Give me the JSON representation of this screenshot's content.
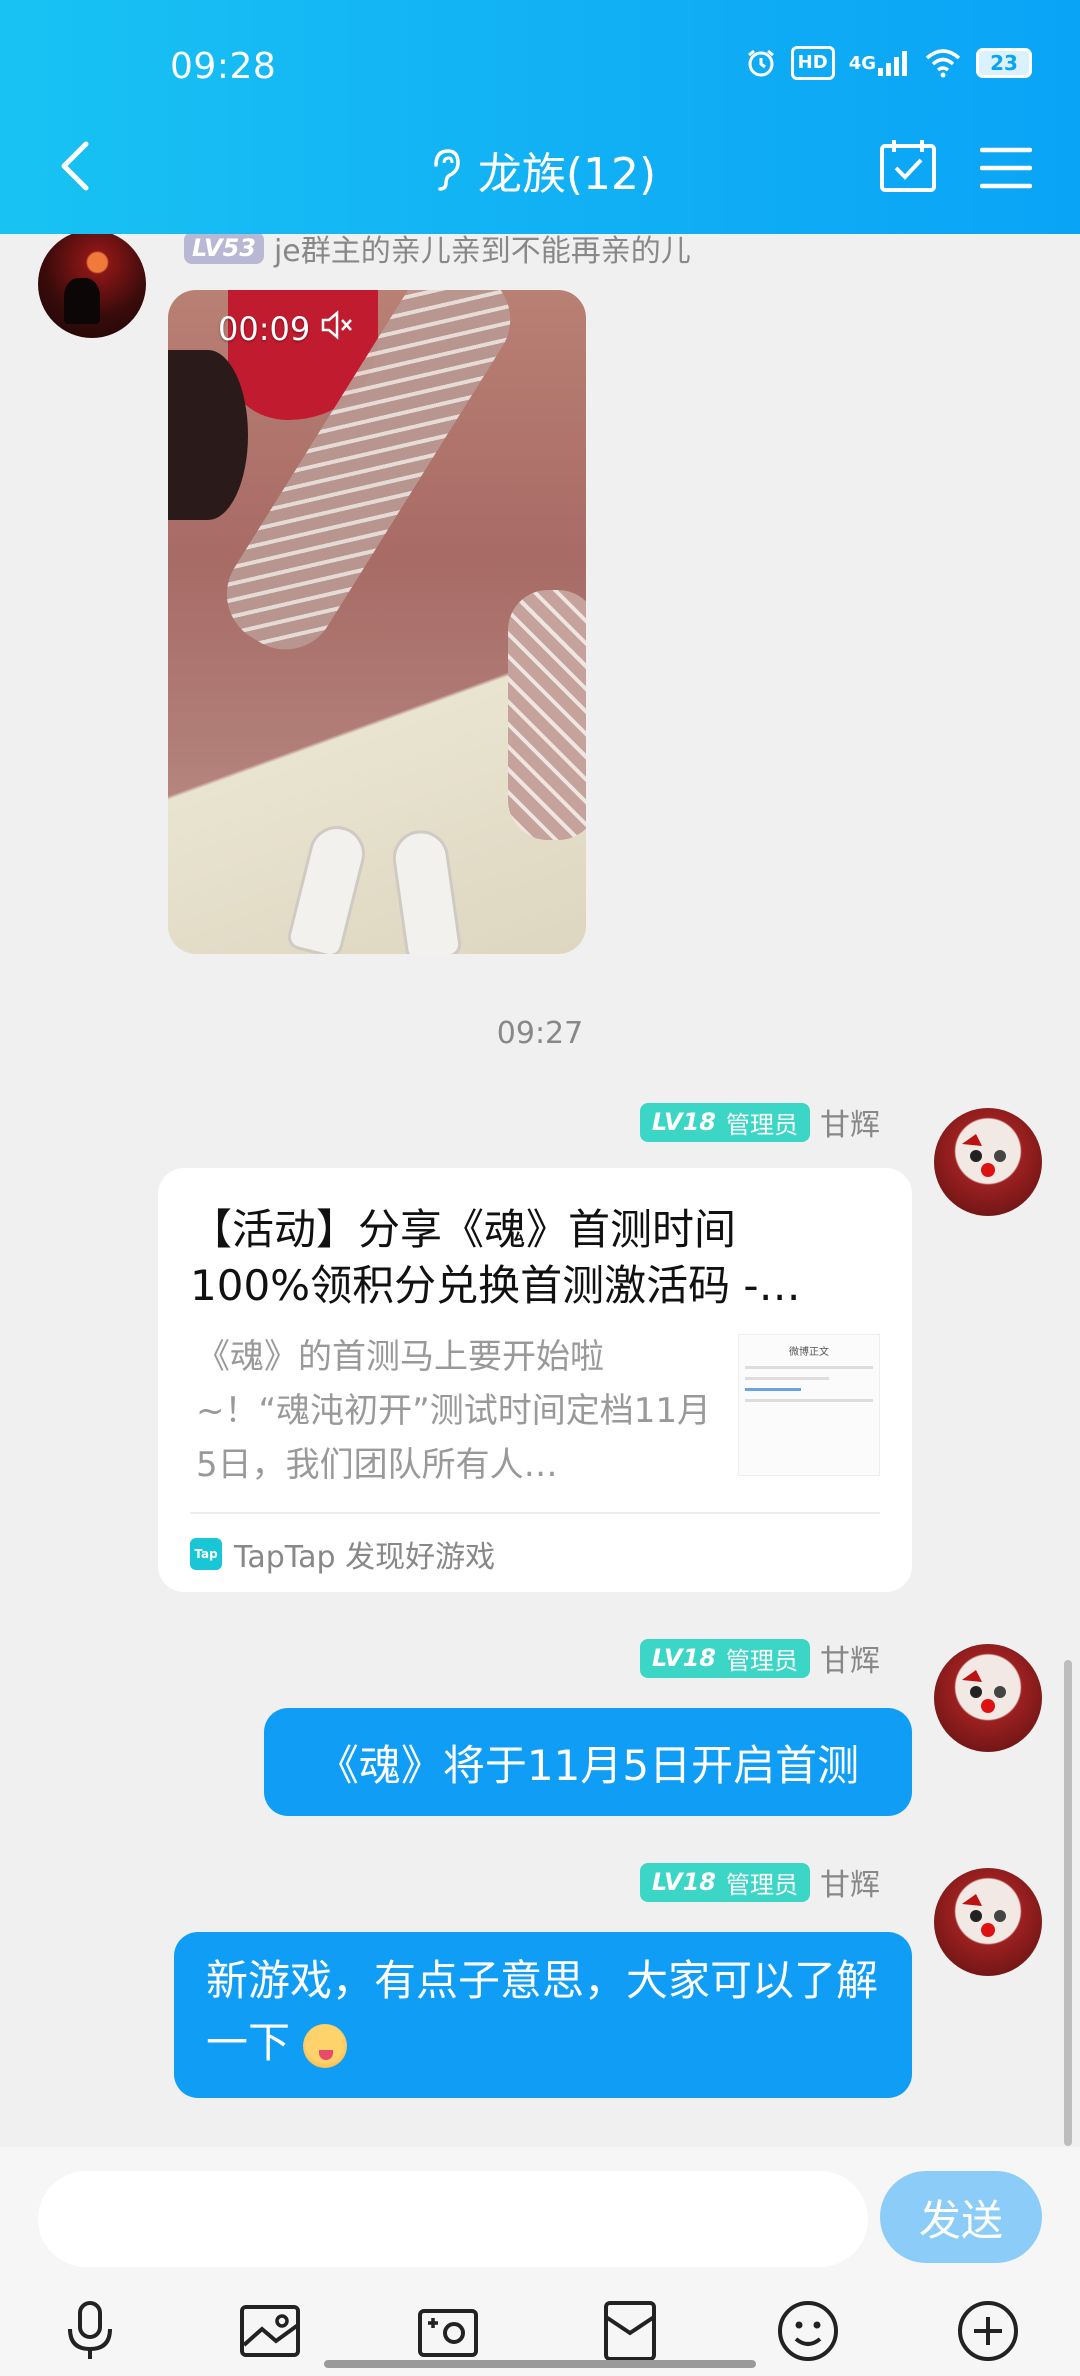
{
  "status_bar": {
    "time": "09:28",
    "hd": "HD",
    "network": "4G",
    "battery": "23"
  },
  "header": {
    "title": "龙族(12)"
  },
  "messages": {
    "first": {
      "level": "LV53",
      "sender": "je群主的亲儿亲到不能再亲的儿",
      "video_duration": "00:09"
    },
    "time_separator": "09:27",
    "admin": {
      "level": "LV18",
      "role": "管理员",
      "name": "甘辉"
    },
    "card": {
      "title_line1": "【活动】分享《魂》首测时间",
      "title_line2": "100%领积分兑换首测激活码 -…",
      "desc": "《魂》的首测马上要开始啦~！“魂沌初开”测试时间定档11月5日，我们团队所有人…",
      "thumb_title": "微博正文",
      "source_logo": "Tap",
      "source": "TapTap 发现好游戏"
    },
    "bubble1": "《魂》将于11月5日开启首测",
    "bubble2": "新游戏，有点子意思，大家可以了解一下"
  },
  "input": {
    "placeholder": "",
    "send_label": "发送"
  },
  "toolbar": {
    "icons": [
      "microphone-icon",
      "image-icon",
      "camera-icon",
      "red-packet-icon",
      "emoji-icon",
      "plus-icon"
    ]
  },
  "colors": {
    "header": "#12b1f4",
    "bubble": "#0f9df6",
    "send_disabled": "#8bcdf8",
    "admin_badge": "#3cd6c7"
  }
}
